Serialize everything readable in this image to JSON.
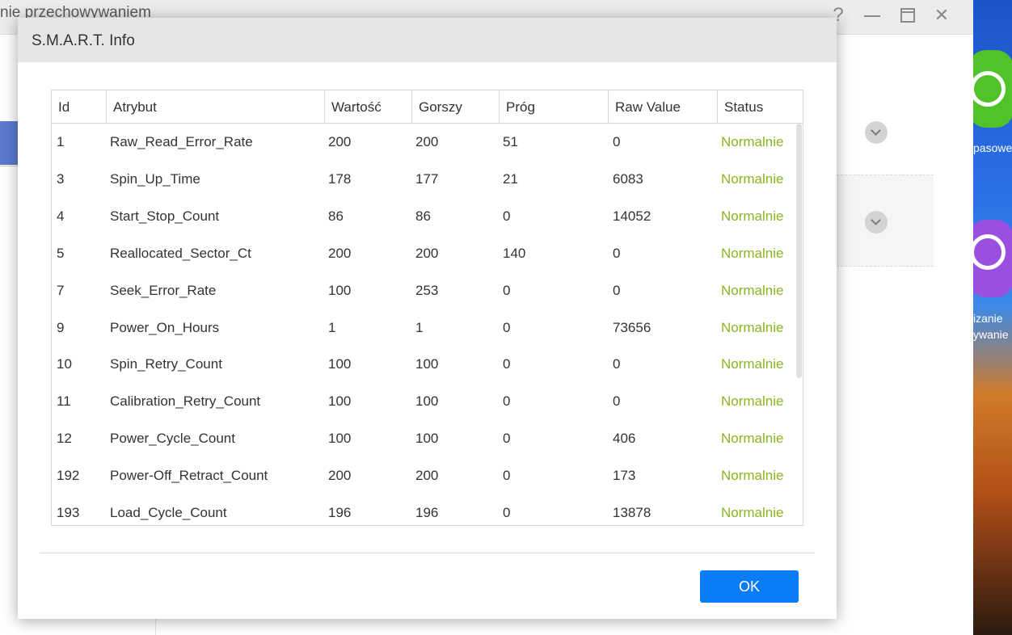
{
  "background_window": {
    "title": "nie przechowywaniem",
    "help_glyph": "?",
    "close_glyph": "✕"
  },
  "desktop": {
    "label_1": "pasowe",
    "label_2": "izanie",
    "label_3": "ywanie",
    "colors": {
      "icon_1": "#52c22b",
      "icon_2": "#9b4fe0"
    }
  },
  "dialog": {
    "title": "S.M.A.R.T. Info",
    "ok_label": "OK",
    "colors": {
      "status_ok": "#8ab521",
      "button": "#0a7cf8",
      "header_bg": "#e6e6e6"
    }
  },
  "table": {
    "columns": [
      "Id",
      "Atrybut",
      "Wartość",
      "Gorszy",
      "Próg",
      "Raw Value",
      "Status"
    ],
    "rows": [
      [
        "1",
        "Raw_Read_Error_Rate",
        "200",
        "200",
        "51",
        "0",
        "Normalnie"
      ],
      [
        "3",
        "Spin_Up_Time",
        "178",
        "177",
        "21",
        "6083",
        "Normalnie"
      ],
      [
        "4",
        "Start_Stop_Count",
        "86",
        "86",
        "0",
        "14052",
        "Normalnie"
      ],
      [
        "5",
        "Reallocated_Sector_Ct",
        "200",
        "200",
        "140",
        "0",
        "Normalnie"
      ],
      [
        "7",
        "Seek_Error_Rate",
        "100",
        "253",
        "0",
        "0",
        "Normalnie"
      ],
      [
        "9",
        "Power_On_Hours",
        "1",
        "1",
        "0",
        "73656",
        "Normalnie"
      ],
      [
        "10",
        "Spin_Retry_Count",
        "100",
        "100",
        "0",
        "0",
        "Normalnie"
      ],
      [
        "11",
        "Calibration_Retry_Count",
        "100",
        "100",
        "0",
        "0",
        "Normalnie"
      ],
      [
        "12",
        "Power_Cycle_Count",
        "100",
        "100",
        "0",
        "406",
        "Normalnie"
      ],
      [
        "192",
        "Power-Off_Retract_Count",
        "200",
        "200",
        "0",
        "173",
        "Normalnie"
      ],
      [
        "193",
        "Load_Cycle_Count",
        "196",
        "196",
        "0",
        "13878",
        "Normalnie"
      ]
    ]
  }
}
